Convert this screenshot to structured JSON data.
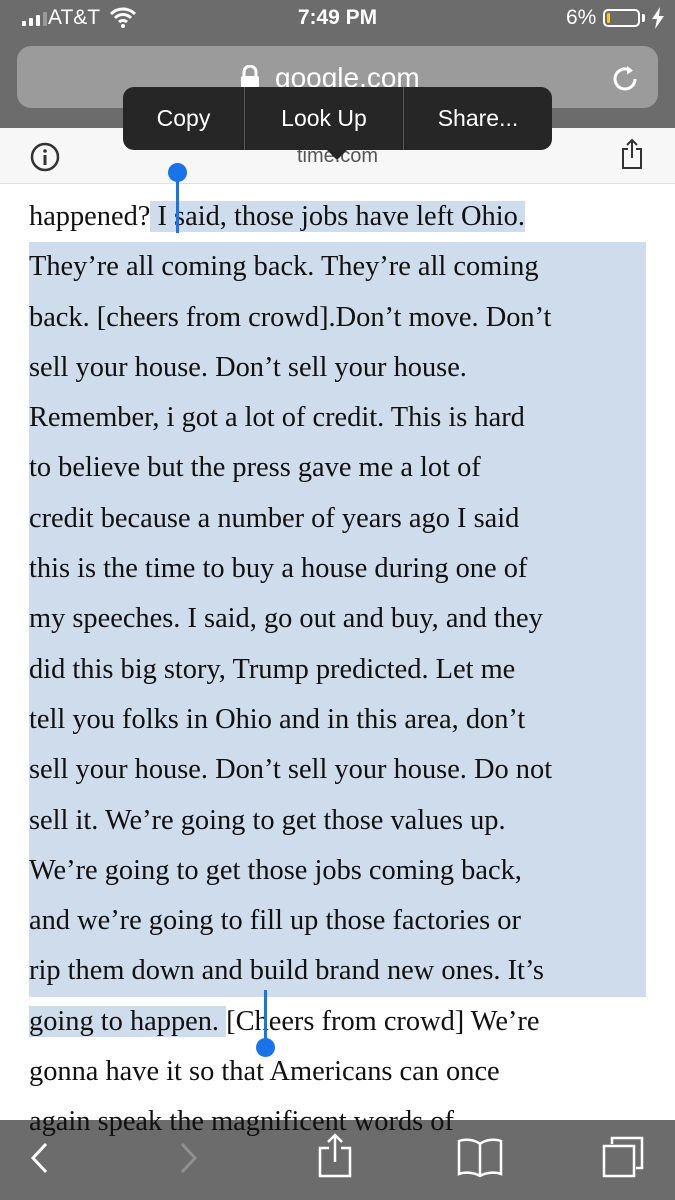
{
  "status": {
    "carrier": "AT&T",
    "time": "7:49 PM",
    "battery_percent": "6%",
    "battery_level": 0.06,
    "battery_color": "#ffc823",
    "icons": [
      "signal-icon",
      "wifi-icon",
      "battery-icon",
      "charging-bolt-icon"
    ]
  },
  "url_bar": {
    "domain": "google.com",
    "icons": [
      "lock-icon",
      "reload-icon"
    ]
  },
  "reader_header": {
    "domain": "time.com",
    "icons": [
      "info-icon",
      "share-icon"
    ]
  },
  "edit_menu": {
    "items": [
      "Copy",
      "Look Up",
      "Share..."
    ]
  },
  "article": {
    "selection_color": "#cfdcec",
    "lines": [
      {
        "before": "happened?",
        "selected": " I said, those jobs have left Ohio."
      },
      {
        "selected": "They’re all coming back. They’re all coming"
      },
      {
        "selected": "back. [cheers from crowd].Don’t move. Don’t"
      },
      {
        "selected": "sell your house. Don’t sell your house."
      },
      {
        "selected": "Remember, i got a lot of credit. This is hard"
      },
      {
        "selected": "to believe but the press gave me a lot of"
      },
      {
        "selected": "credit because a number of years ago I said"
      },
      {
        "selected": "this is the time to buy a house during one of"
      },
      {
        "selected": "my speeches. I said, go out and buy, and they"
      },
      {
        "selected": "did this big story, Trump predicted. Let me"
      },
      {
        "selected": "tell you folks in Ohio and in this area, don’t"
      },
      {
        "selected": "sell your house. Don’t sell your house. Do not"
      },
      {
        "selected": "sell it. We’re going to get those values up."
      },
      {
        "selected": "We’re going to get those jobs coming back,"
      },
      {
        "selected": "and we’re going to fill up those factories or"
      },
      {
        "selected": "rip them down and build brand new ones. It’s"
      },
      {
        "selected": "going to happen. ",
        "after": "[Cheers from crowd] We’re"
      },
      {
        "after": "gonna have it so that Americans can once"
      },
      {
        "after": "again speak the magnificent words of"
      }
    ]
  },
  "toolbar": {
    "icons": [
      "back-icon",
      "forward-icon",
      "share-icon",
      "bookmarks-icon",
      "tabs-icon"
    ]
  }
}
